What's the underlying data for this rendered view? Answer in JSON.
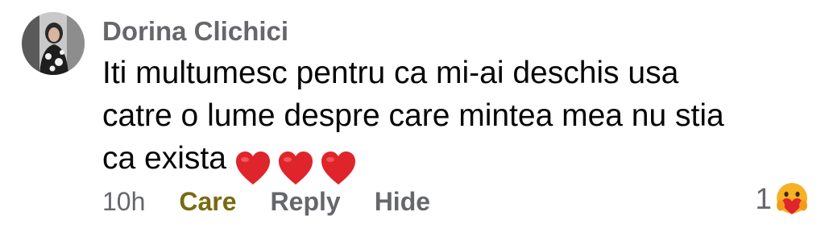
{
  "comment": {
    "author": "Dorina Clichici",
    "text_lines": [
      "Iti multumesc pentru ca mi-ai deschis usa",
      "catre o lume despre care mintea mea nu stia",
      "ca exista"
    ],
    "emoji": [
      "red-heart",
      "red-heart",
      "red-heart"
    ],
    "timestamp": "10h",
    "actions": {
      "care": "Care",
      "reply": "Reply",
      "hide": "Hide"
    },
    "reactions": {
      "count": "1",
      "icon": "care-emoji"
    }
  },
  "colors": {
    "secondary_text": "#65676b",
    "care_reaction": "#7a6a10",
    "heart": "#e0242b",
    "care_face": "#f7b125"
  }
}
